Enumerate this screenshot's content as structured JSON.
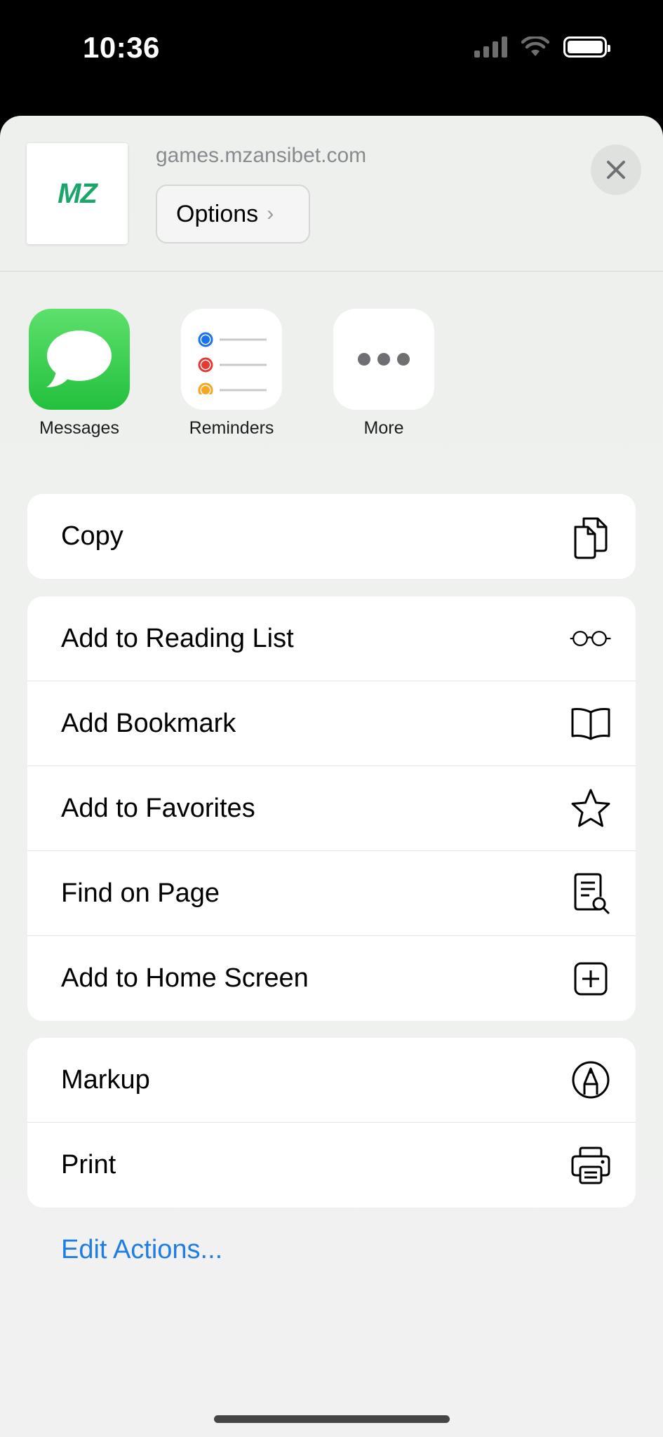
{
  "status_bar": {
    "time": "10:36"
  },
  "header": {
    "thumbnail_text": "MZ",
    "url": "games.mzansibet.com",
    "options_label": "Options",
    "options_chevron": "›"
  },
  "apps": [
    {
      "label": "Messages",
      "icon": "messages-icon"
    },
    {
      "label": "Reminders",
      "icon": "reminders-icon"
    },
    {
      "label": "More",
      "icon": "more-icon"
    }
  ],
  "actions": {
    "copy": "Copy",
    "group2": [
      {
        "label": "Add to Reading List",
        "icon": "glasses-icon"
      },
      {
        "label": "Add Bookmark",
        "icon": "book-icon"
      },
      {
        "label": "Add to Favorites",
        "icon": "star-icon"
      },
      {
        "label": "Find on Page",
        "icon": "find-doc-icon"
      },
      {
        "label": "Add to Home Screen",
        "icon": "plus-square-icon"
      }
    ],
    "group3": [
      {
        "label": "Markup",
        "icon": "markup-icon"
      },
      {
        "label": "Print",
        "icon": "printer-icon"
      }
    ]
  },
  "edit_actions": "Edit Actions...",
  "colors": {
    "accent": "#1f7ee2",
    "brand_green": "#1aa56a"
  }
}
